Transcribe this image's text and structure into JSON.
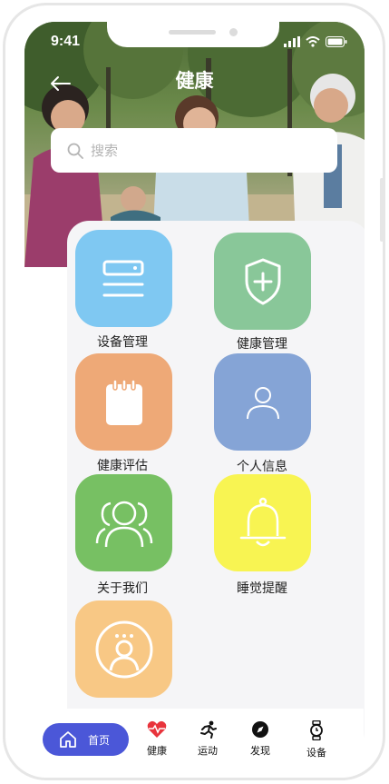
{
  "status_bar": {
    "time": "9:41"
  },
  "header": {
    "title": "健康"
  },
  "search": {
    "placeholder": "搜索"
  },
  "menu": {
    "items": [
      {
        "label": "设备管理",
        "icon": "device-list-icon",
        "color": "#7fc8f2"
      },
      {
        "label": "健康管理",
        "icon": "shield-plus-icon",
        "color": "#89c799"
      },
      {
        "label": "健康评估",
        "icon": "notepad-icon",
        "color": "#eea977"
      },
      {
        "label": "个人信息",
        "icon": "person-icon",
        "color": "#85a4d6"
      },
      {
        "label": "关于我们",
        "icon": "group-icon",
        "color": "#77c063"
      },
      {
        "label": "睡觉提醒",
        "icon": "bell-icon",
        "color": "#f8f452"
      },
      {
        "label": "",
        "icon": "chat-user-icon",
        "color": "#f8c885"
      }
    ]
  },
  "tabbar": {
    "items": [
      {
        "label": "首页",
        "icon": "home-icon",
        "active": true
      },
      {
        "label": "健康",
        "icon": "heart-pulse-icon"
      },
      {
        "label": "运动",
        "icon": "running-icon"
      },
      {
        "label": "发现",
        "icon": "compass-icon"
      },
      {
        "label": "设备",
        "icon": "watch-icon"
      }
    ],
    "accent": "#4b57d8"
  }
}
